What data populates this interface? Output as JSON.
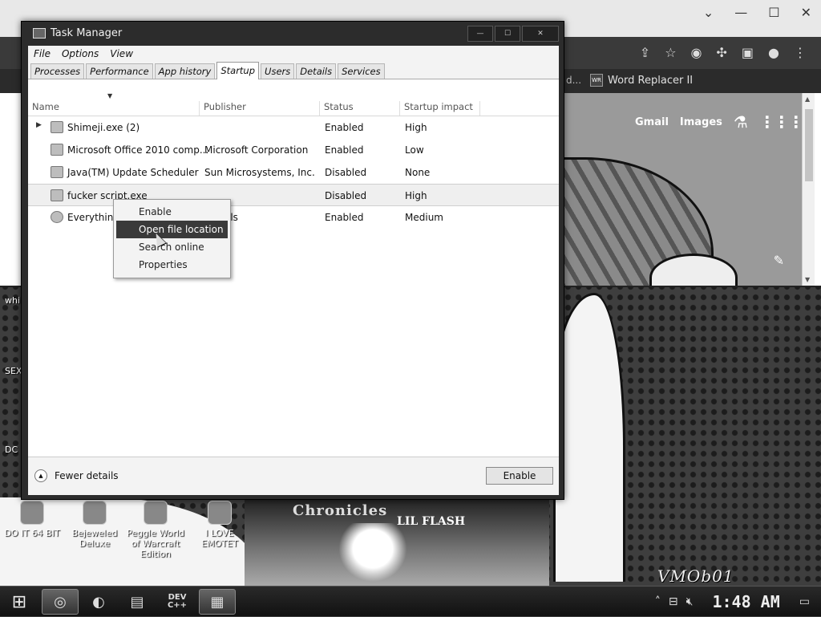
{
  "browser": {
    "bookmark_fragment": "d...",
    "bookmark_label": "Word Replacer II",
    "bookmark_badge": "WR",
    "google_links": [
      "Gmail",
      "Images"
    ]
  },
  "desktop": {
    "icons": [
      "DO IT 64 BIT",
      "Bejeweled Deluxe",
      "Peggle World of Warcraft Edition",
      "I LOVE EMOTET"
    ],
    "side_labels": [
      "whi",
      "SEX",
      "DC"
    ],
    "poster_title": "Chronicles",
    "poster_subtitle": "LIL FLASH",
    "watermark": "VMOb01"
  },
  "task_manager": {
    "title": "Task Manager",
    "menu": [
      "File",
      "Options",
      "View"
    ],
    "tabs": [
      "Processes",
      "Performance",
      "App history",
      "Startup",
      "Users",
      "Details",
      "Services"
    ],
    "active_tab": "Startup",
    "columns": [
      "Name",
      "Publisher",
      "Status",
      "Startup impact"
    ],
    "rows": [
      {
        "name": "Shimeji.exe (2)",
        "publisher": "",
        "status": "Enabled",
        "impact": "High"
      },
      {
        "name": "Microsoft Office 2010 comp...",
        "publisher": "Microsoft Corporation",
        "status": "Enabled",
        "impact": "Low"
      },
      {
        "name": "Java(TM) Update Scheduler",
        "publisher": "Sun Microsystems, Inc.",
        "status": "Disabled",
        "impact": "None"
      },
      {
        "name": "fucker script.exe",
        "publisher": "",
        "status": "Disabled",
        "impact": "High"
      },
      {
        "name": "Everything",
        "publisher": "ols",
        "status": "Enabled",
        "impact": "Medium"
      }
    ],
    "footer": {
      "fewer_details": "Fewer details",
      "enable_button": "Enable"
    }
  },
  "context_menu": {
    "items": [
      "Enable",
      "Open file location",
      "Search online",
      "Properties"
    ],
    "highlighted": "Open file location"
  },
  "taskbar": {
    "clock": "1:48 AM",
    "dev_label": "DEV C++"
  }
}
